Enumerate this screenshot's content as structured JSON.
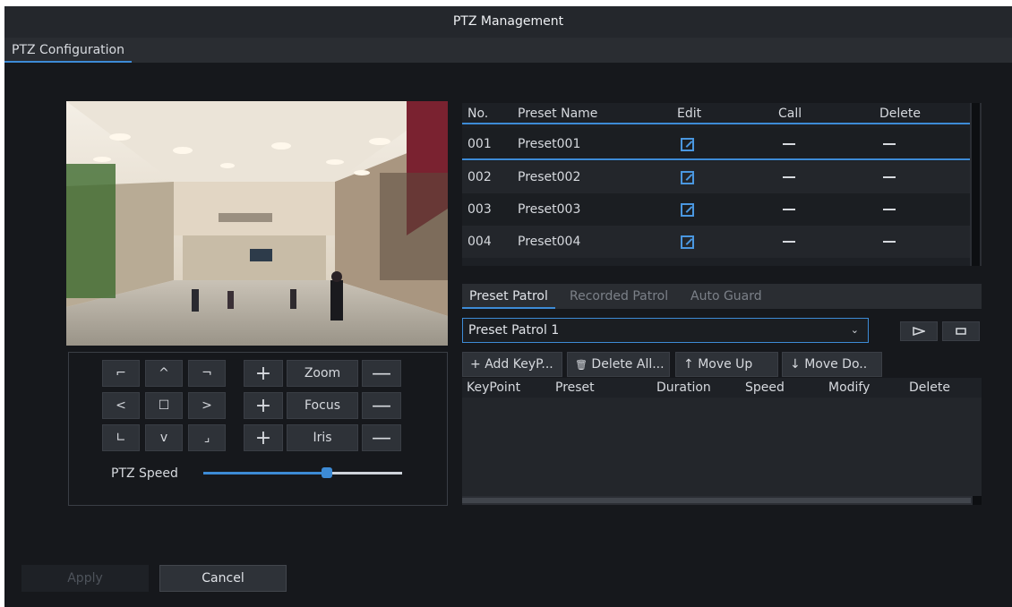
{
  "window": {
    "title": "PTZ Management"
  },
  "tabs": {
    "active": "PTZ Configuration"
  },
  "ptz": {
    "direction_icons": [
      "top-left-arrow-icon",
      "up-arrow-icon",
      "top-right-arrow-icon",
      "left-arrow-icon",
      "center-stop-icon",
      "right-arrow-icon",
      "bottom-left-arrow-icon",
      "down-arrow-icon",
      "bottom-right-arrow-icon"
    ],
    "direction_glyphs": [
      "⌐",
      "^",
      "¬",
      "<",
      "☐",
      ">",
      "∟",
      "v",
      "⌟"
    ],
    "lens": [
      {
        "label": "Zoom",
        "plus": "+",
        "minus": "—"
      },
      {
        "label": "Focus",
        "plus": "+",
        "minus": "—"
      },
      {
        "label": "Iris",
        "plus": "+",
        "minus": "—"
      }
    ],
    "speed_label": "PTZ Speed",
    "speed_level": 0.62
  },
  "presets": {
    "headers": [
      "No.",
      "Preset Name",
      "Edit",
      "Call",
      "Delete"
    ],
    "rows": [
      {
        "no": "001",
        "name": "Preset001",
        "edit": "edit-icon",
        "call": "—",
        "delete": "—"
      },
      {
        "no": "002",
        "name": "Preset002",
        "edit": "edit-icon",
        "call": "—",
        "delete": "—"
      },
      {
        "no": "003",
        "name": "Preset003",
        "edit": "edit-icon",
        "call": "—",
        "delete": "—"
      },
      {
        "no": "004",
        "name": "Preset004",
        "edit": "edit-icon",
        "call": "—",
        "delete": "—"
      }
    ]
  },
  "patrol": {
    "tabs": [
      "Preset Patrol",
      "Recorded Patrol",
      "Auto Guard"
    ],
    "active_tab": "Preset Patrol",
    "selected": "Preset Patrol 1",
    "play_icon": "play-icon",
    "stop_icon": "stop-icon",
    "buttons": [
      {
        "icon": "plus-icon",
        "glyph": "+",
        "label": "Add KeyP..."
      },
      {
        "icon": "trash-icon",
        "glyph": "🗑",
        "label": "Delete All..."
      },
      {
        "icon": "arrow-up-icon",
        "glyph": "↑",
        "label": "Move Up"
      },
      {
        "icon": "arrow-down-icon",
        "glyph": "↓",
        "label": "Move Do.."
      }
    ],
    "keypoint_headers": [
      "KeyPoint",
      "Preset",
      "Duration",
      "Speed",
      "Modify",
      "Delete"
    ]
  },
  "footer": {
    "apply": "Apply",
    "cancel": "Cancel"
  },
  "colors": {
    "accent": "#3d8bd6",
    "background": "#16181c",
    "panel": "#2a2d32"
  }
}
